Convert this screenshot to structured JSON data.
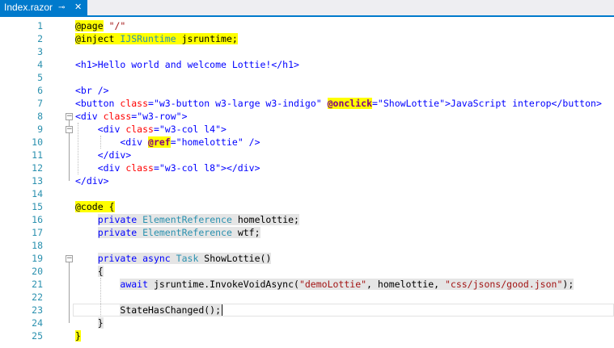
{
  "tab": {
    "title": "Index.razor",
    "pin_glyph": "⊸",
    "close_glyph": "✕"
  },
  "editor": {
    "lines": [
      {
        "num": "1",
        "tokens": [
          {
            "t": "@page",
            "c": "tok-dir"
          },
          {
            "t": " "
          },
          {
            "t": "\"/\"",
            "c": "tok-str"
          }
        ]
      },
      {
        "num": "2",
        "tokens": [
          {
            "t": "@inject",
            "c": "tok-dir"
          },
          {
            "t": " ",
            "c": "tok-dir"
          },
          {
            "t": "IJSRuntime",
            "c": "tok-type tok-dir"
          },
          {
            "t": " jsruntime;",
            "c": "tok-dir"
          }
        ]
      },
      {
        "num": "3",
        "tokens": []
      },
      {
        "num": "4",
        "tokens": [
          {
            "t": "<h1>Hello world and welcome Lottie!</h1>",
            "c": "tok-kw"
          }
        ]
      },
      {
        "num": "5",
        "tokens": []
      },
      {
        "num": "6",
        "tokens": [
          {
            "t": "<br />",
            "c": "tok-kw"
          }
        ]
      },
      {
        "num": "7",
        "tokens": [
          {
            "t": "<button ",
            "c": "tok-kw"
          },
          {
            "t": "class",
            "c": "tok-attr"
          },
          {
            "t": "=",
            "c": "tok-kw"
          },
          {
            "t": "\"w3-button w3-large w3-indigo\"",
            "c": "tok-kw"
          },
          {
            "t": " "
          },
          {
            "t": "@onclick",
            "c": "tok-ev tok-dir"
          },
          {
            "t": "=\"ShowLottie\">JavaScript interop</button>",
            "c": "tok-kw"
          }
        ]
      },
      {
        "num": "8",
        "tokens": [
          {
            "t": "<div ",
            "c": "tok-kw"
          },
          {
            "t": "class",
            "c": "tok-attr"
          },
          {
            "t": "=",
            "c": "tok-kw"
          },
          {
            "t": "\"w3-row\">",
            "c": "tok-kw"
          }
        ]
      },
      {
        "num": "9",
        "tokens": [
          {
            "t": "    <div ",
            "c": "tok-kw"
          },
          {
            "t": "class",
            "c": "tok-attr"
          },
          {
            "t": "=",
            "c": "tok-kw"
          },
          {
            "t": "\"w3-col l4\">",
            "c": "tok-kw"
          }
        ]
      },
      {
        "num": "10",
        "tokens": [
          {
            "t": "        <div ",
            "c": "tok-kw"
          },
          {
            "t": "@ref",
            "c": "tok-ev tok-dir"
          },
          {
            "t": "=",
            "c": "tok-kw"
          },
          {
            "t": "\"homelottie\"",
            "c": "tok-kw"
          },
          {
            "t": " />",
            "c": "tok-kw"
          }
        ]
      },
      {
        "num": "11",
        "tokens": [
          {
            "t": "    </div>",
            "c": "tok-kw"
          }
        ]
      },
      {
        "num": "12",
        "tokens": [
          {
            "t": "    <div ",
            "c": "tok-kw"
          },
          {
            "t": "class",
            "c": "tok-attr"
          },
          {
            "t": "=",
            "c": "tok-kw"
          },
          {
            "t": "\"w3-col l8\"></div>",
            "c": "tok-kw"
          }
        ]
      },
      {
        "num": "13",
        "tokens": [
          {
            "t": "</div>",
            "c": "tok-kw"
          }
        ]
      },
      {
        "num": "14",
        "tokens": []
      },
      {
        "num": "15",
        "tokens": [
          {
            "t": "@code",
            "c": "tok-dir"
          },
          {
            "t": " ",
            "c": "tok-dir"
          },
          {
            "t": "{",
            "c": "tok-dir"
          }
        ]
      },
      {
        "num": "16",
        "tokens": [
          {
            "t": "    "
          },
          {
            "t": "private",
            "c": "tok-kw tok-sel"
          },
          {
            "t": " ",
            "c": "tok-sel"
          },
          {
            "t": "ElementReference",
            "c": "tok-type tok-sel"
          },
          {
            "t": " homelottie;",
            "c": "tok-sel"
          }
        ]
      },
      {
        "num": "17",
        "tokens": [
          {
            "t": "    "
          },
          {
            "t": "private",
            "c": "tok-kw tok-sel"
          },
          {
            "t": " ",
            "c": "tok-sel"
          },
          {
            "t": "ElementReference",
            "c": "tok-type tok-sel"
          },
          {
            "t": " wtf;",
            "c": "tok-sel"
          }
        ]
      },
      {
        "num": "18",
        "tokens": []
      },
      {
        "num": "19",
        "tokens": [
          {
            "t": "    "
          },
          {
            "t": "private",
            "c": "tok-kw tok-sel"
          },
          {
            "t": " ",
            "c": "tok-sel"
          },
          {
            "t": "async",
            "c": "tok-kw tok-sel"
          },
          {
            "t": " ",
            "c": "tok-sel"
          },
          {
            "t": "Task",
            "c": "tok-type tok-sel"
          },
          {
            "t": " ShowLottie()",
            "c": "tok-sel"
          }
        ]
      },
      {
        "num": "20",
        "tokens": [
          {
            "t": "    "
          },
          {
            "t": "{",
            "c": "tok-sel"
          }
        ]
      },
      {
        "num": "21",
        "tokens": [
          {
            "t": "        "
          },
          {
            "t": "await",
            "c": "tok-kw tok-sel"
          },
          {
            "t": " jsruntime.InvokeVoidAsync(",
            "c": "tok-sel"
          },
          {
            "t": "\"demoLottie\"",
            "c": "tok-str tok-sel"
          },
          {
            "t": ", homelottie, ",
            "c": "tok-sel"
          },
          {
            "t": "\"css/jsons/good.json\"",
            "c": "tok-str tok-sel"
          },
          {
            "t": ");",
            "c": "tok-sel"
          }
        ]
      },
      {
        "num": "22",
        "tokens": []
      },
      {
        "num": "23",
        "tokens": [
          {
            "t": "        "
          },
          {
            "t": "StateHasChanged();",
            "c": "tok-sel"
          }
        ]
      },
      {
        "num": "24",
        "tokens": [
          {
            "t": "    "
          },
          {
            "t": "}",
            "c": "tok-sel"
          }
        ]
      },
      {
        "num": "25",
        "tokens": [
          {
            "t": "}",
            "c": "tok-dir"
          }
        ]
      }
    ]
  },
  "colors": {
    "accent": "#007acc",
    "line_number": "#2b91af",
    "keyword": "#0000ff",
    "string": "#a31515",
    "razor_highlight": "#ffff00"
  }
}
